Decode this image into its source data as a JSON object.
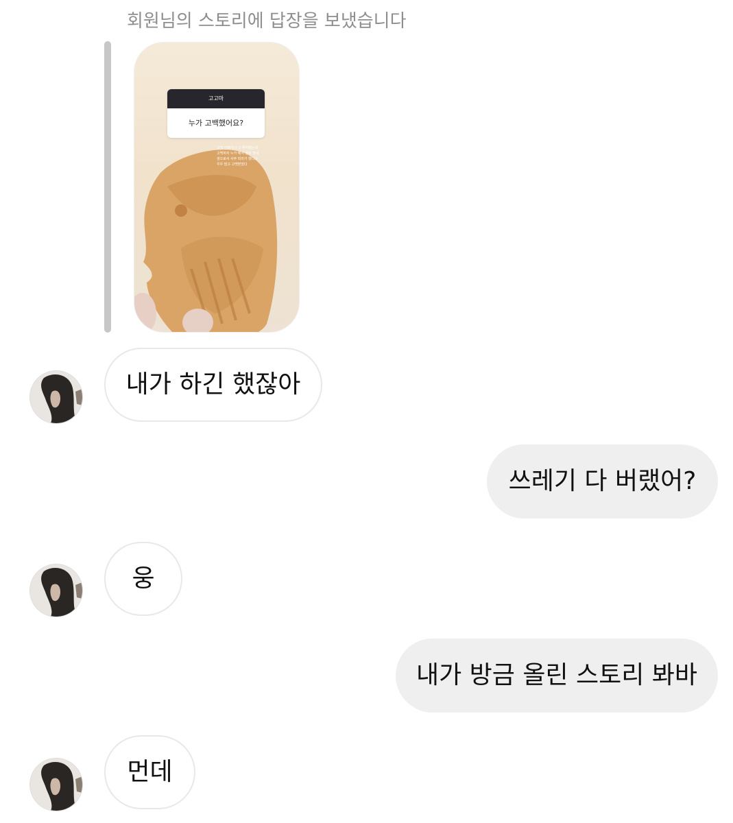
{
  "reply_header": {
    "caption": "회원님의 스토리에 답장을 보냈습니다"
  },
  "story": {
    "sticker_title": "고고마",
    "sticker_question": "누가 고백했어요?",
    "note_lines": [
      "고백 안했거나 고 좋아했는데",
      "고백하자 누가 해서 같이 받네",
      "생으로서 사주 되라가 했다고",
      "우우 많고 고백받았다"
    ]
  },
  "messages": [
    {
      "side": "in",
      "text": "내가 하긴 했잖아"
    },
    {
      "side": "out",
      "text": "쓰레기 다 버랬어?"
    },
    {
      "side": "in",
      "text": "웅"
    },
    {
      "side": "out",
      "text": "내가 방금 올린 스토리 봐바"
    },
    {
      "side": "in",
      "text": "먼데"
    }
  ],
  "colors": {
    "incoming_bubble": "#ffffff",
    "incoming_border": "#e8e8e8",
    "outgoing_bubble": "#efefef",
    "caption": "#8e8e8e",
    "reply_bar": "#c7c7c7"
  },
  "icons": {
    "avatar": "profile-photo-avatar"
  }
}
